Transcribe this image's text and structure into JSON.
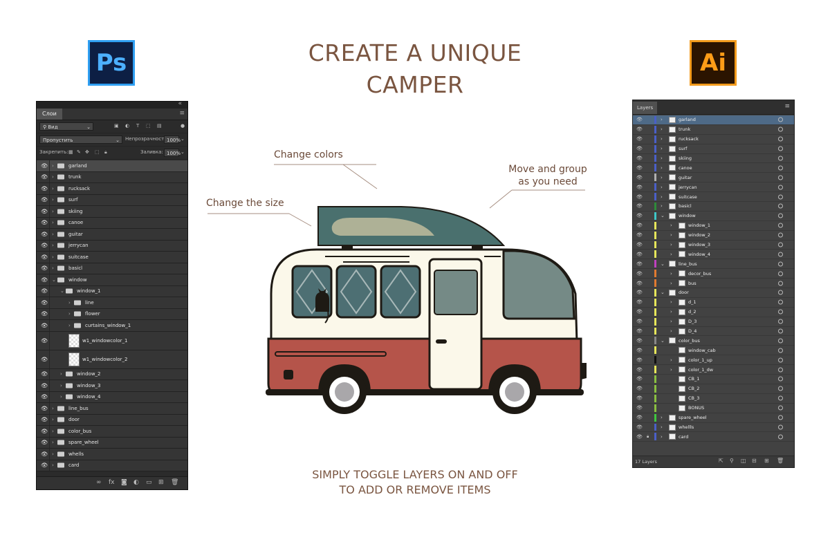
{
  "title_line1": "CREATE A UNIQUE",
  "title_line2": "CAMPER",
  "bottom_line1": "SIMPLY TOGGLE LAYERS ON AND OFF",
  "bottom_line2": "TO ADD OR REMOVE ITEMS",
  "callouts": {
    "colors": "Change colors",
    "size": "Change the size",
    "group_line1": "Move and group",
    "group_line2": "as you need"
  },
  "ps_logo": "Ps",
  "ai_logo": "Ai",
  "photoshop": {
    "tab": "Слои",
    "filter_label": "Вид",
    "blend_mode": "Пропустить",
    "opacity_label": "Непрозрачность:",
    "opacity_value": "100%",
    "lock_label": "Закрепить:",
    "fill_label": "Заливка:",
    "fill_value": "100%",
    "layers": [
      {
        "name": "garland"
      },
      {
        "name": "trunk"
      },
      {
        "name": "rucksack"
      },
      {
        "name": "surf"
      },
      {
        "name": "skiing"
      },
      {
        "name": "canoe"
      },
      {
        "name": "guitar"
      },
      {
        "name": "jerrycan"
      },
      {
        "name": "suitcase"
      },
      {
        "name": "basicl"
      },
      {
        "name": "window"
      },
      {
        "name": "window_1"
      },
      {
        "name": "line"
      },
      {
        "name": "flower"
      },
      {
        "name": "curtains_window_1"
      },
      {
        "name": "w1_windowcolor_1"
      },
      {
        "name": "w1_windowcolor_2"
      },
      {
        "name": "window_2"
      },
      {
        "name": "window_3"
      },
      {
        "name": "window_4"
      },
      {
        "name": "line_bus"
      },
      {
        "name": "door"
      },
      {
        "name": "color_bus"
      },
      {
        "name": "spare_wheel"
      },
      {
        "name": "whells"
      },
      {
        "name": "card"
      }
    ]
  },
  "illustrator": {
    "tab": "Layers",
    "count": "17 Layers",
    "layers": [
      {
        "name": "garland",
        "color": "#4a5fc8"
      },
      {
        "name": "trunk",
        "color": "#4a5fc8"
      },
      {
        "name": "rucksack",
        "color": "#4a5fc8"
      },
      {
        "name": "surf",
        "color": "#4a5fc8"
      },
      {
        "name": "skiing",
        "color": "#4a5fc8"
      },
      {
        "name": "canoe",
        "color": "#4a5fc8"
      },
      {
        "name": "guitar",
        "color": "#b0b0b0"
      },
      {
        "name": "jerrycan",
        "color": "#4a5fc8"
      },
      {
        "name": "suitcase",
        "color": "#4a5fc8"
      },
      {
        "name": "basicl",
        "color": "#2e8b3a"
      },
      {
        "name": "window",
        "color": "#3ec8c8"
      },
      {
        "name": "window_1",
        "color": "#e6e65a"
      },
      {
        "name": "window_2",
        "color": "#e6e65a"
      },
      {
        "name": "window_3",
        "color": "#e6e65a"
      },
      {
        "name": "window_4",
        "color": "#e6e65a"
      },
      {
        "name": "line_bus",
        "color": "#c040c0"
      },
      {
        "name": "decor_bus",
        "color": "#e07a30"
      },
      {
        "name": "bus",
        "color": "#e07a30"
      },
      {
        "name": "door",
        "color": "#e6e65a"
      },
      {
        "name": "d_1",
        "color": "#e6e65a"
      },
      {
        "name": "d_2",
        "color": "#e6e65a"
      },
      {
        "name": "D_3",
        "color": "#e6e65a"
      },
      {
        "name": "D_4",
        "color": "#e6e65a"
      },
      {
        "name": "color_bus",
        "color": "#888888"
      },
      {
        "name": "window_cab",
        "color": "#e6e65a"
      },
      {
        "name": "color_1_up",
        "color": "#111111"
      },
      {
        "name": "color_1_dw",
        "color": "#e6e65a"
      },
      {
        "name": "CB_1",
        "color": "#8ac040"
      },
      {
        "name": "CB_2",
        "color": "#8ac040"
      },
      {
        "name": "CB_3",
        "color": "#8ac040"
      },
      {
        "name": "BONUS",
        "color": "#8ac040"
      },
      {
        "name": "spare_wheel",
        "color": "#3ec83e"
      },
      {
        "name": "whellls",
        "color": "#4a5fc8"
      },
      {
        "name": "card",
        "color": "#4a5fc8"
      }
    ]
  },
  "colors": {
    "roof_box": "#4a706e",
    "bus_red": "#b5544a",
    "bus_cream": "#fbf8ea",
    "window_teal": "#4d6f73",
    "cab_window": "#758a86",
    "outline": "#1e1a14",
    "text_brown": "#7a5540"
  }
}
